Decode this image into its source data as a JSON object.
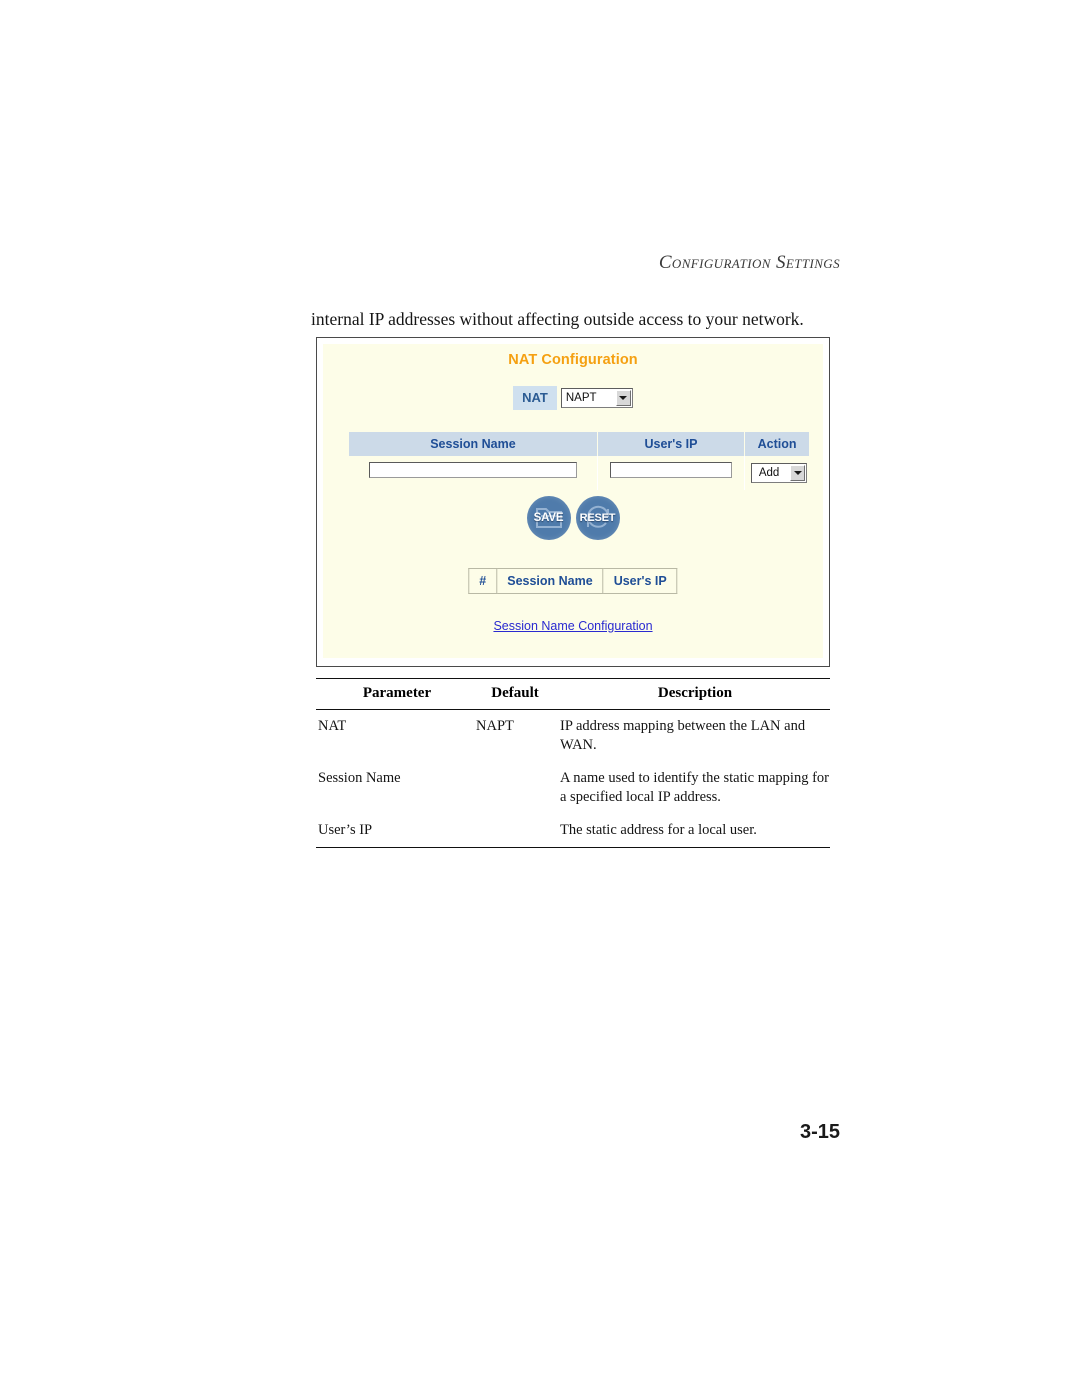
{
  "page": {
    "running_header": "Configuration Settings",
    "intro_text": "internal IP addresses without affecting outside access to your network.",
    "page_number": "3-15"
  },
  "panel": {
    "title": "NAT Configuration",
    "title_color": "#f5a011",
    "background": "#fdfde8",
    "nat": {
      "label": "NAT",
      "select_value": "NAPT",
      "options": [
        "NAPT"
      ]
    },
    "entry_table": {
      "headers": [
        "Session Name",
        "User's IP",
        "Action"
      ],
      "row": {
        "session_name_value": "",
        "users_ip_value": "",
        "action_value": "Add",
        "action_options": [
          "Add"
        ]
      }
    },
    "buttons": [
      {
        "label": "SAVE",
        "icon": "folder-icon"
      },
      {
        "label": "RESET",
        "icon": "refresh-icon"
      }
    ],
    "list_table": {
      "headers": [
        "#",
        "Session Name",
        "User's IP"
      ],
      "rows": []
    },
    "link": {
      "label": "Session Name Configuration",
      "color": "#2a2ad0"
    }
  },
  "param_table": {
    "headers": [
      "Parameter",
      "Default",
      "Description"
    ],
    "rows": [
      {
        "parameter": "NAT",
        "default": "NAPT",
        "description": "IP address mapping between the LAN and WAN."
      },
      {
        "parameter": "Session Name",
        "default": "",
        "description": "A name used to identify the static mapping for a specified local IP address."
      },
      {
        "parameter": "User’s IP",
        "default": "",
        "description": "The static address for a local user."
      }
    ]
  }
}
